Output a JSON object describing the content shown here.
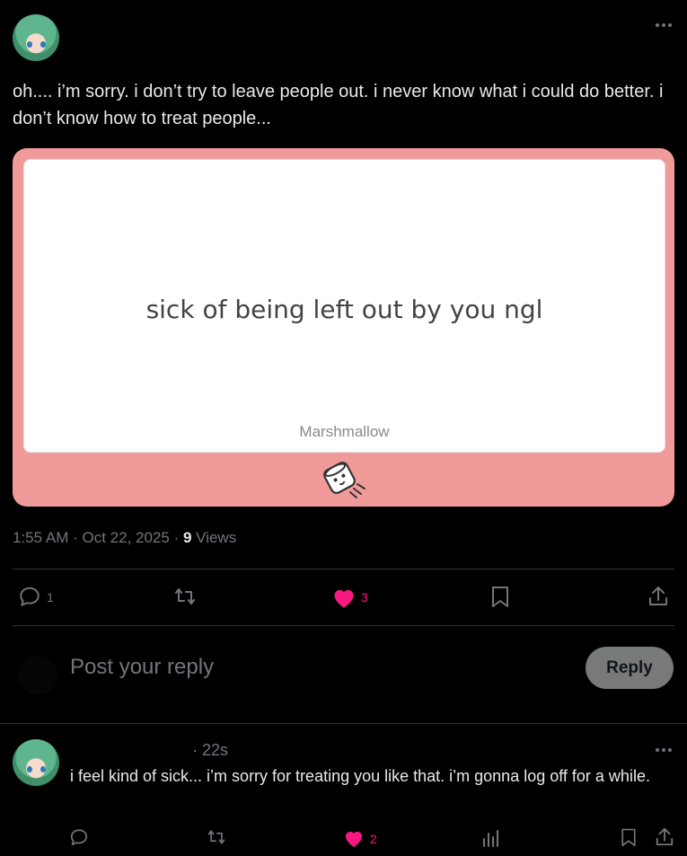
{
  "main_post": {
    "text": "oh.... i’m sorry. i don’t try to leave people out. i never know what i could do better. i don’t know how to treat people...",
    "card": {
      "message": "sick of being left out by you ngl",
      "brand": "Marshmallow"
    },
    "time": "1:55 AM",
    "date": "Oct 22, 2025",
    "views_count": "9",
    "views_label": "Views",
    "stats": {
      "replies": "1",
      "likes": "3"
    }
  },
  "composer": {
    "placeholder": "Post your reply",
    "button_label": "Reply"
  },
  "reply_post": {
    "time_ago": "· 22s",
    "text": "i feel kind of sick... i’m sorry for treating you like that. i’m gonna log off for a while.",
    "likes": "2"
  },
  "colors": {
    "accent_like": "#f91880",
    "card_bg": "#f19a9a"
  }
}
